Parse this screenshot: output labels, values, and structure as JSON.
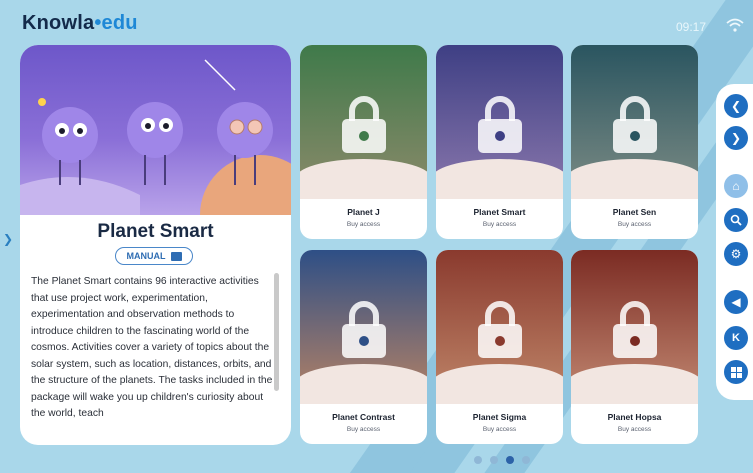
{
  "app": {
    "brand_main": "Knowla",
    "brand_dot": "•",
    "brand_suffix": "edu",
    "clock": "09:17"
  },
  "detail": {
    "title": "Planet Smart",
    "manual_label": "MANUAL",
    "description": "The Planet Smart contains 96 interactive activities that use project work, experimentation, experimentation and observation methods to introduce children to the fascinating world of the cosmos. Activities cover a variety of topics about the solar system, such as location, distances, orbits, and the structure of the planets. The tasks included in the package will wake you up children's curiosity about the world, teach"
  },
  "planets": [
    {
      "name": "Planet J",
      "status": "Buy access",
      "bg_top": "#3f7a4a",
      "bg_bottom": "#8d8a6b"
    },
    {
      "name": "Planet Smart",
      "status": "Buy access",
      "bg_top": "#3e3f84",
      "bg_bottom": "#8b78ad"
    },
    {
      "name": "Planet Sen",
      "status": "Buy access",
      "bg_top": "#2a5560",
      "bg_bottom": "#7d8c85"
    },
    {
      "name": "Planet Contrast",
      "status": "Buy access",
      "bg_top": "#2e4f86",
      "bg_bottom": "#b88364"
    },
    {
      "name": "Planet Sigma",
      "status": "Buy access",
      "bg_top": "#8a3a2e",
      "bg_bottom": "#c0876a"
    },
    {
      "name": "Planet Hopsa",
      "status": "Buy access",
      "bg_top": "#7b2b23",
      "bg_bottom": "#c38a73"
    }
  ],
  "sidebar": {
    "icons": [
      "chevron-left-icon",
      "chevron-right-icon",
      "home-icon",
      "search-icon",
      "gear-icon",
      "speaker-icon",
      "k-logo-icon",
      "windows-icon"
    ]
  },
  "pager": {
    "pages": 4,
    "active": 3
  },
  "colors": {
    "accent": "#1f6ec1",
    "background": "#a9d7ea"
  }
}
